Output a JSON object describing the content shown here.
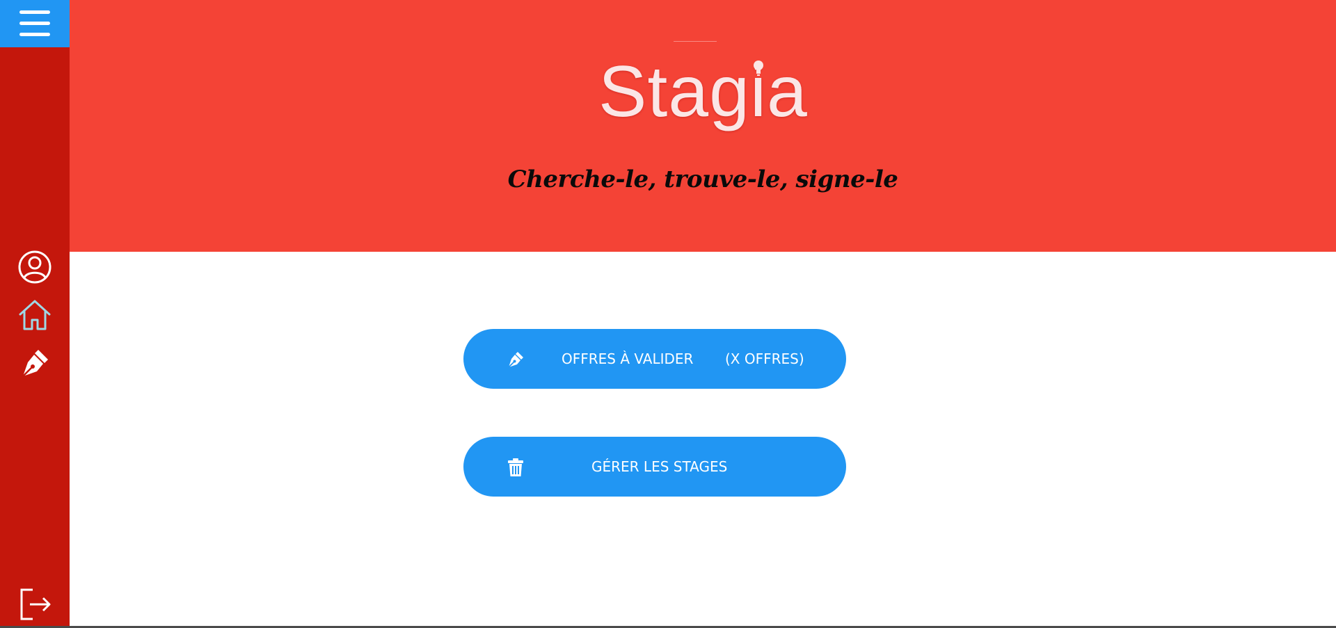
{
  "app": {
    "brand": "Stagia",
    "tagline": "Cherche-le, trouve-le, signe-le"
  },
  "colors": {
    "sidebar": "#c4170c",
    "menu_toggle": "#2196f3",
    "banner": "#f44336",
    "button": "#2196f3"
  },
  "sidebar": {
    "icons": [
      "menu-icon",
      "user-icon",
      "home-icon",
      "pen-icon",
      "logout-icon"
    ]
  },
  "actions": {
    "validate_label": "OFFRES À VALIDER",
    "validate_count": "(X OFFRES)",
    "validate_icon": "pen-icon",
    "manage_label": "GÉRER LES STAGES",
    "manage_icon": "trash-icon"
  }
}
